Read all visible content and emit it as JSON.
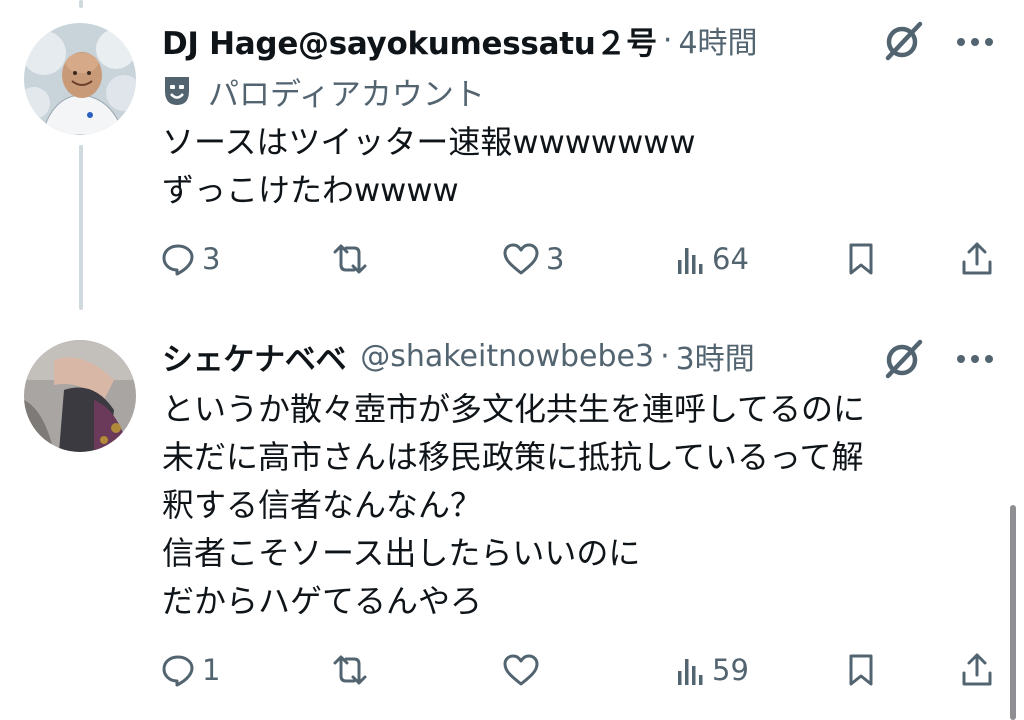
{
  "tweets": [
    {
      "name": "DJ Hage@sayokumessatu２号",
      "handle": "",
      "time": "4時間",
      "label": "パロディアカウント",
      "lines": [
        "ソースはツイッター速報wwwwwww",
        "ずっこけたわwwww"
      ],
      "replies": "3",
      "reposts": "",
      "likes": "3",
      "views": "64"
    },
    {
      "name": "シェケナベベ",
      "handle": "@shakeitnowbebe3",
      "time": "3時間",
      "lines": [
        "というか散々壺市が多文化共生を連呼してるのに",
        "未だに高市さんは移民政策に抵抗しているって解",
        "釈する信者なんなん？",
        "信者こそソース出したらいいのに",
        "だからハゲてるんやろ"
      ],
      "replies": "1",
      "reposts": "",
      "likes": "",
      "views": "59"
    }
  ],
  "separator": "·",
  "icons": {
    "reply": "reply-icon",
    "repost": "repost-icon",
    "like": "heart-icon",
    "views": "bar-chart-icon",
    "bookmark": "bookmark-icon",
    "share": "share-icon",
    "grok": "grok-icon",
    "more": "more-icon",
    "parody": "theater-mask-icon"
  },
  "colors": {
    "text": "#0f1419",
    "secondary": "#536471",
    "thread_line": "#cfd9de"
  }
}
